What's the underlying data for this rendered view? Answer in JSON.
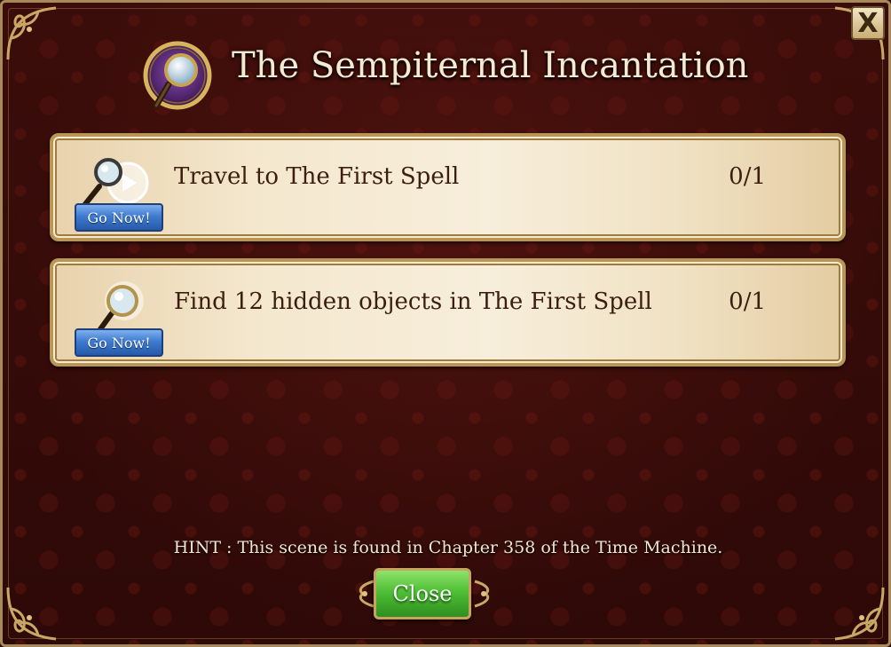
{
  "dialog": {
    "title": "The Sempiternal Incantation",
    "close_x_label": "X",
    "title_icon": "magnifying-glass-icon"
  },
  "tasks": [
    {
      "label": "Travel to The First Spell",
      "progress": "0/1",
      "button_label": "Go Now!",
      "icon": "magnifying-glass-play-icon"
    },
    {
      "label": "Find 12 hidden objects in The First Spell",
      "progress": "0/1",
      "button_label": "Go Now!",
      "icon": "magnifying-glass-icon"
    }
  ],
  "hint": "HINT : This scene is found in Chapter 358 of the Time Machine.",
  "footer": {
    "close_label": "Close"
  },
  "colors": {
    "background": "#2d0907",
    "panel": "#f4e7cd",
    "gold_border": "#b89656",
    "go_button": "#3e7bd0",
    "close_button": "#4fbf36"
  }
}
